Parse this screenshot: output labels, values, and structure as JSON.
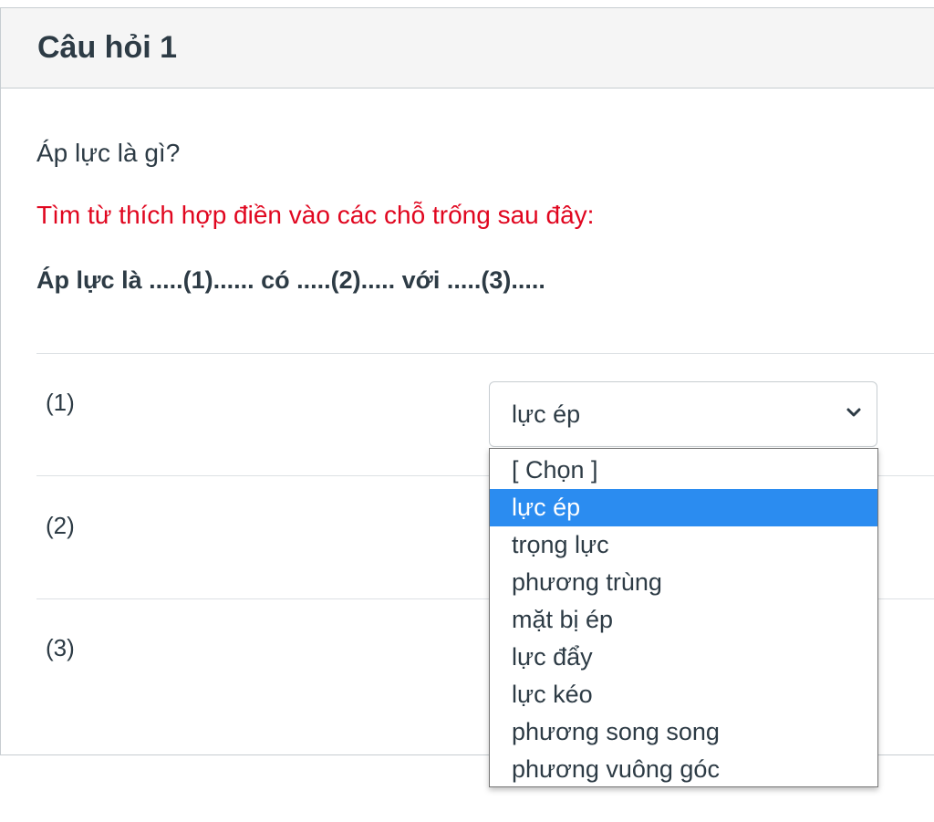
{
  "header": {
    "title": "Câu hỏi 1"
  },
  "question": {
    "prompt": "Áp lực là gì?",
    "instruction": "Tìm từ thích hợp điền vào các chỗ trống sau đây:",
    "statement": "Áp lực là .....(1)...... có .....(2)..... với .....(3)....."
  },
  "blanks": [
    {
      "label": "(1)",
      "selected_value": "lực ép"
    },
    {
      "label": "(2)"
    },
    {
      "label": "(3)"
    }
  ],
  "dropdown": {
    "icon": "chevron-down-icon",
    "options": [
      "[ Chọn ]",
      "lực ép",
      "trọng lực",
      "phương trùng",
      "mặt bị ép",
      "lực đẩy",
      "lực kéo",
      "phương song song",
      "phương vuông góc"
    ],
    "highlighted_index": 1,
    "highlight_color": "#2b8cf0"
  },
  "colors": {
    "instruction_text": "#e0061f",
    "header_bg": "#f5f5f5"
  }
}
